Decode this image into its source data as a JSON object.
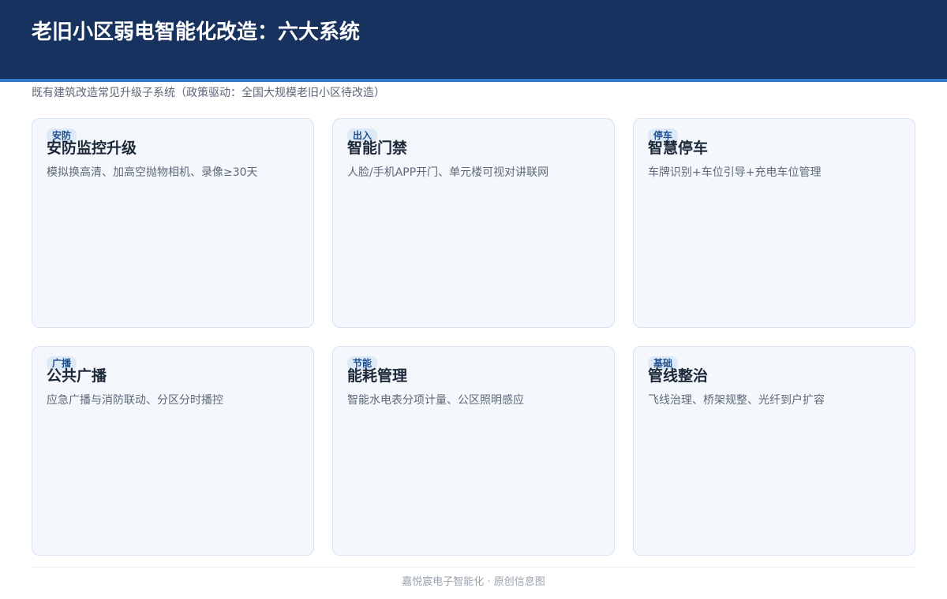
{
  "header": {
    "title": "老旧小区弱电智能化改造：六大系统"
  },
  "subtitle": "既有建筑改造常见升级子系统（政策驱动：全国大规模老旧小区待改造）",
  "cards": [
    {
      "tag": "安防",
      "title": "安防监控升级",
      "desc": "模拟换高清、加高空抛物相机、录像≥30天"
    },
    {
      "tag": "出入",
      "title": "智能门禁",
      "desc": "人脸/手机APP开门、单元楼可视对讲联网"
    },
    {
      "tag": "停车",
      "title": "智慧停车",
      "desc": "车牌识别+车位引导+充电车位管理"
    },
    {
      "tag": "广播",
      "title": "公共广播",
      "desc": "应急广播与消防联动、分区分时播控"
    },
    {
      "tag": "节能",
      "title": "能耗管理",
      "desc": "智能水电表分项计量、公区照明感应"
    },
    {
      "tag": "基础",
      "title": "管线整治",
      "desc": "飞线治理、桥架规整、光纤到户扩容"
    }
  ],
  "footer": "嘉悦宸电子智能化 · 原创信息图",
  "colors": {
    "header_bg": "#17325e",
    "accent_bar": "#3277c8",
    "card_bg": "#f4f8fc",
    "card_border": "#d6e2f0",
    "tag_bg": "#dde9f7",
    "tag_text": "#1f4f8e"
  }
}
